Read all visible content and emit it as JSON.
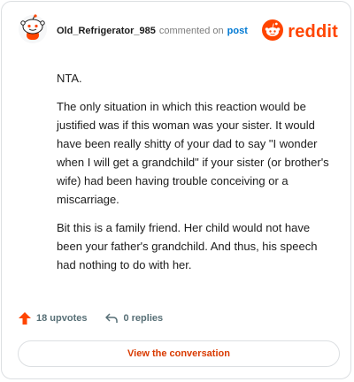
{
  "header": {
    "username": "Old_Refrigerator_985",
    "action_text": "commented on",
    "post_link": "post",
    "brand_name": "reddit",
    "icons": {
      "avatar": "snoo-avatar-icon",
      "brand": "reddit-logo-icon"
    }
  },
  "comment": {
    "paragraphs": [
      "NTA.",
      "The only situation in which this reaction would be justified was if this woman was your sister. It would have been really shitty of your dad to say \"I wonder when I will get a grandchild\" if your sister (or brother's wife) had been having trouble conceiving or a miscarriage.",
      "Bit this is a family friend. Her child would not have been your father's grandchild. And thus, his speech had nothing to do with her."
    ]
  },
  "footer": {
    "upvotes": "18 upvotes",
    "replies": "0 replies",
    "cta": "View the conversation",
    "icons": {
      "upvote": "upvote-arrow-icon",
      "reply": "reply-arrow-icon"
    }
  },
  "colors": {
    "brand": "#ff4500",
    "link": "#0079d3",
    "muted": "#7c7c7c",
    "text": "#1c1c1c",
    "border": "#dcdfe2"
  }
}
